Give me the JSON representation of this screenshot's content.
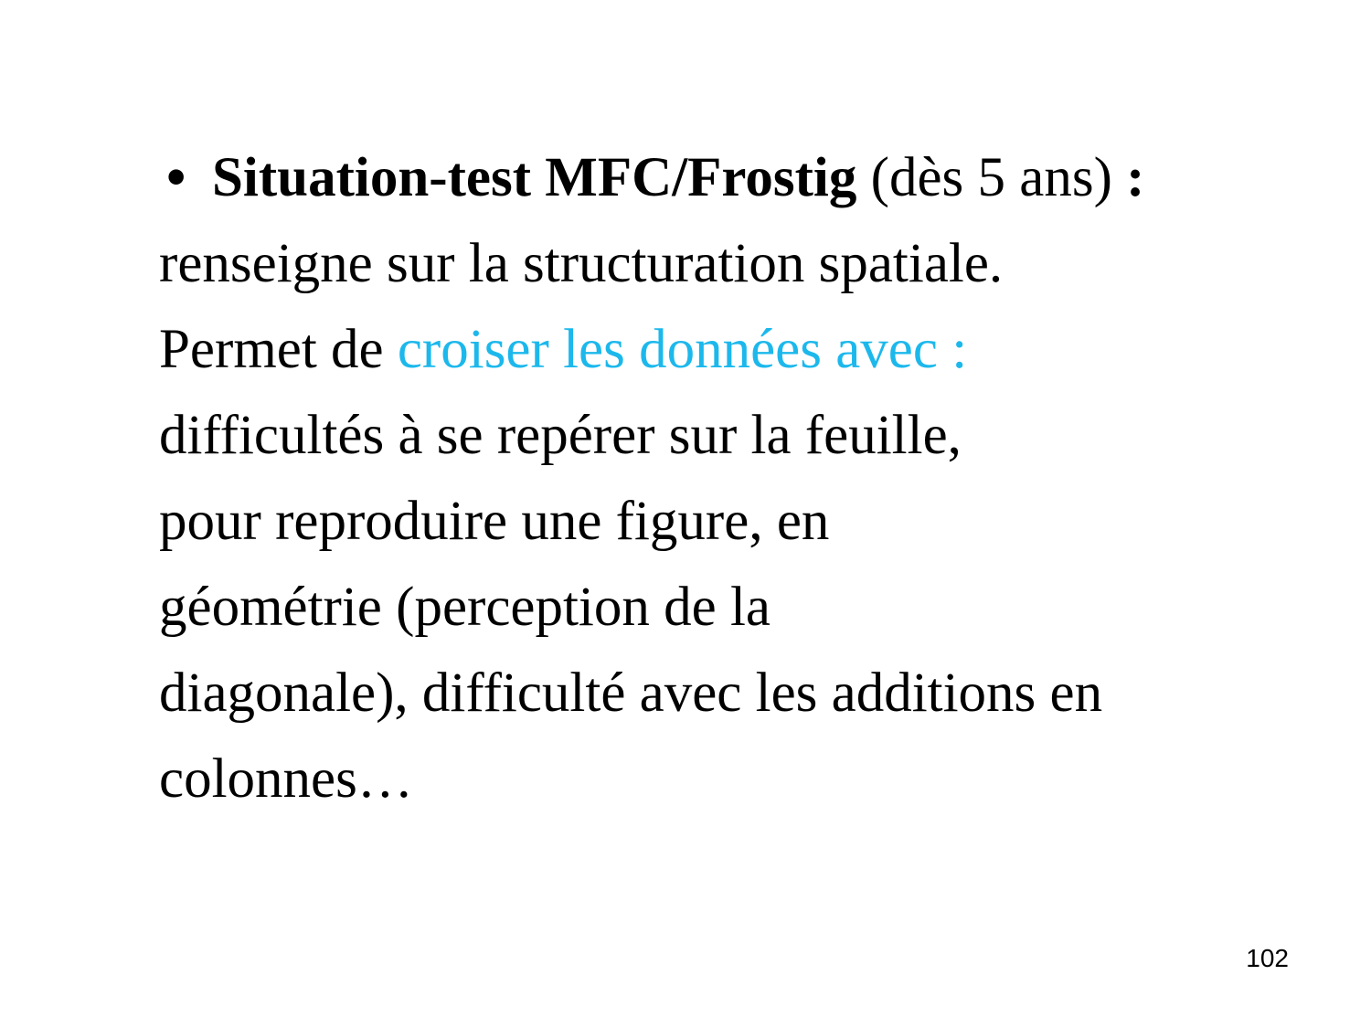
{
  "slide": {
    "bullet_symbol": "•",
    "heading_bold": "Situation-test MFC/Frostig",
    "heading_normal": " (dès 5 ans) ",
    "heading_colon": ":",
    "line2": "renseigne sur la structuration spatiale.",
    "line3_prefix": "Permet de ",
    "line3_highlight": "croiser les données avec :",
    "line4": "difficultés à se repérer sur la feuille,",
    "line5": "pour reproduire une figure, en",
    "line6": "géométrie (perception de la",
    "line7": "diagonale), difficulté avec les additions en",
    "line8": "colonnes…",
    "page_number": "102"
  },
  "colors": {
    "text": "#000000",
    "highlight": "#1cb8ec",
    "background": "#ffffff"
  }
}
